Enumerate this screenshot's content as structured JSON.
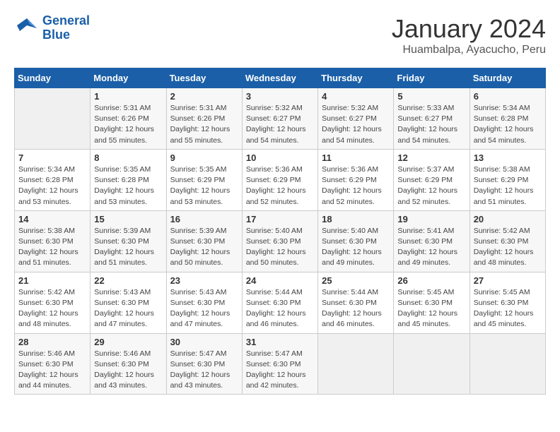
{
  "header": {
    "logo_line1": "General",
    "logo_line2": "Blue",
    "month": "January 2024",
    "location": "Huambalpa, Ayacucho, Peru"
  },
  "weekdays": [
    "Sunday",
    "Monday",
    "Tuesday",
    "Wednesday",
    "Thursday",
    "Friday",
    "Saturday"
  ],
  "weeks": [
    [
      {
        "day": "",
        "info": ""
      },
      {
        "day": "1",
        "info": "Sunrise: 5:31 AM\nSunset: 6:26 PM\nDaylight: 12 hours\nand 55 minutes."
      },
      {
        "day": "2",
        "info": "Sunrise: 5:31 AM\nSunset: 6:26 PM\nDaylight: 12 hours\nand 55 minutes."
      },
      {
        "day": "3",
        "info": "Sunrise: 5:32 AM\nSunset: 6:27 PM\nDaylight: 12 hours\nand 54 minutes."
      },
      {
        "day": "4",
        "info": "Sunrise: 5:32 AM\nSunset: 6:27 PM\nDaylight: 12 hours\nand 54 minutes."
      },
      {
        "day": "5",
        "info": "Sunrise: 5:33 AM\nSunset: 6:27 PM\nDaylight: 12 hours\nand 54 minutes."
      },
      {
        "day": "6",
        "info": "Sunrise: 5:34 AM\nSunset: 6:28 PM\nDaylight: 12 hours\nand 54 minutes."
      }
    ],
    [
      {
        "day": "7",
        "info": "Sunrise: 5:34 AM\nSunset: 6:28 PM\nDaylight: 12 hours\nand 53 minutes."
      },
      {
        "day": "8",
        "info": "Sunrise: 5:35 AM\nSunset: 6:28 PM\nDaylight: 12 hours\nand 53 minutes."
      },
      {
        "day": "9",
        "info": "Sunrise: 5:35 AM\nSunset: 6:29 PM\nDaylight: 12 hours\nand 53 minutes."
      },
      {
        "day": "10",
        "info": "Sunrise: 5:36 AM\nSunset: 6:29 PM\nDaylight: 12 hours\nand 52 minutes."
      },
      {
        "day": "11",
        "info": "Sunrise: 5:36 AM\nSunset: 6:29 PM\nDaylight: 12 hours\nand 52 minutes."
      },
      {
        "day": "12",
        "info": "Sunrise: 5:37 AM\nSunset: 6:29 PM\nDaylight: 12 hours\nand 52 minutes."
      },
      {
        "day": "13",
        "info": "Sunrise: 5:38 AM\nSunset: 6:29 PM\nDaylight: 12 hours\nand 51 minutes."
      }
    ],
    [
      {
        "day": "14",
        "info": "Sunrise: 5:38 AM\nSunset: 6:30 PM\nDaylight: 12 hours\nand 51 minutes."
      },
      {
        "day": "15",
        "info": "Sunrise: 5:39 AM\nSunset: 6:30 PM\nDaylight: 12 hours\nand 51 minutes."
      },
      {
        "day": "16",
        "info": "Sunrise: 5:39 AM\nSunset: 6:30 PM\nDaylight: 12 hours\nand 50 minutes."
      },
      {
        "day": "17",
        "info": "Sunrise: 5:40 AM\nSunset: 6:30 PM\nDaylight: 12 hours\nand 50 minutes."
      },
      {
        "day": "18",
        "info": "Sunrise: 5:40 AM\nSunset: 6:30 PM\nDaylight: 12 hours\nand 49 minutes."
      },
      {
        "day": "19",
        "info": "Sunrise: 5:41 AM\nSunset: 6:30 PM\nDaylight: 12 hours\nand 49 minutes."
      },
      {
        "day": "20",
        "info": "Sunrise: 5:42 AM\nSunset: 6:30 PM\nDaylight: 12 hours\nand 48 minutes."
      }
    ],
    [
      {
        "day": "21",
        "info": "Sunrise: 5:42 AM\nSunset: 6:30 PM\nDaylight: 12 hours\nand 48 minutes."
      },
      {
        "day": "22",
        "info": "Sunrise: 5:43 AM\nSunset: 6:30 PM\nDaylight: 12 hours\nand 47 minutes."
      },
      {
        "day": "23",
        "info": "Sunrise: 5:43 AM\nSunset: 6:30 PM\nDaylight: 12 hours\nand 47 minutes."
      },
      {
        "day": "24",
        "info": "Sunrise: 5:44 AM\nSunset: 6:30 PM\nDaylight: 12 hours\nand 46 minutes."
      },
      {
        "day": "25",
        "info": "Sunrise: 5:44 AM\nSunset: 6:30 PM\nDaylight: 12 hours\nand 46 minutes."
      },
      {
        "day": "26",
        "info": "Sunrise: 5:45 AM\nSunset: 6:30 PM\nDaylight: 12 hours\nand 45 minutes."
      },
      {
        "day": "27",
        "info": "Sunrise: 5:45 AM\nSunset: 6:30 PM\nDaylight: 12 hours\nand 45 minutes."
      }
    ],
    [
      {
        "day": "28",
        "info": "Sunrise: 5:46 AM\nSunset: 6:30 PM\nDaylight: 12 hours\nand 44 minutes."
      },
      {
        "day": "29",
        "info": "Sunrise: 5:46 AM\nSunset: 6:30 PM\nDaylight: 12 hours\nand 43 minutes."
      },
      {
        "day": "30",
        "info": "Sunrise: 5:47 AM\nSunset: 6:30 PM\nDaylight: 12 hours\nand 43 minutes."
      },
      {
        "day": "31",
        "info": "Sunrise: 5:47 AM\nSunset: 6:30 PM\nDaylight: 12 hours\nand 42 minutes."
      },
      {
        "day": "",
        "info": ""
      },
      {
        "day": "",
        "info": ""
      },
      {
        "day": "",
        "info": ""
      }
    ]
  ]
}
